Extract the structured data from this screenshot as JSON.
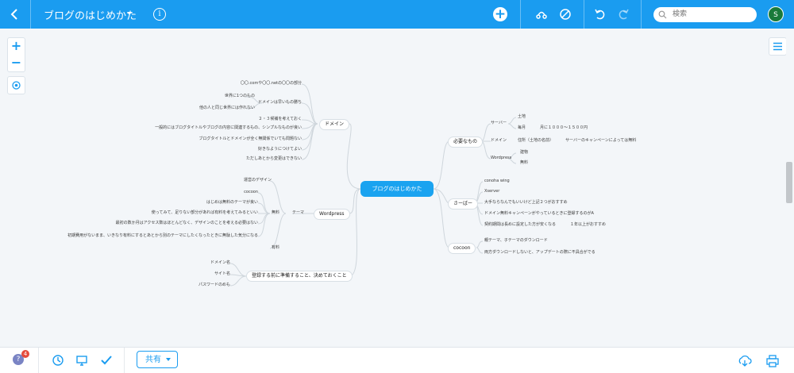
{
  "header": {
    "title": "ブログのはじめかた",
    "search_placeholder": "検索",
    "avatar_initial": "S",
    "accent": "#1a9cf0"
  },
  "bottom": {
    "share_label": "共有",
    "help_glyph": "?",
    "notification_count": "4"
  },
  "mindmap": {
    "root": "ブログのはじめかた",
    "domain": {
      "label": "ドメイン",
      "items": [
        "〇〇.comや〇〇.netの〇〇の部分",
        "世界に1つのもの",
        "ドメインは早いもの勝ち",
        "他の人と同じ世界には作れない",
        "２・３候補を考えておく",
        "一般的にはブログタイトルやブログの内容に関連するもの、シンプルなものが良い",
        "ブログタイトルとドメインが全く無関係でいても問題ない",
        "好きなようにつけてよい",
        "ただしあとから変更はできない"
      ]
    },
    "wordpress": {
      "label": "Wordpress",
      "theme_label": "テーマ",
      "paid_label": "無料",
      "free_label": "有料",
      "items": [
        "運営のデザイン",
        "cocoon",
        "はじめは無料のテーマが良い",
        "使ってみて、足りない部分があれば有料を考えてみるといい",
        "最初の数か月はアクセス数はほとんどなく、デザインのことを考える必要はない",
        "初期費用がないまま、いきなり有料にするとあとから別のテーマにしたくなったときに無駄した気分になる"
      ]
    },
    "prep": {
      "label": "登録する前に準備すること、決めておくこと",
      "items": [
        "ドメイン名",
        "サイト名",
        "パスワードのめも"
      ]
    },
    "needs": {
      "label": "必要なもの",
      "server_label": "サーバー",
      "rent_label": "土地",
      "cost_label": "毎月",
      "cost_value": "月に１０００〜１５００円",
      "domain_label": "ドメイン",
      "domain_note": "住所（土地の名前）",
      "domain_campaign": "サーバーのキャンペーンによっては無料",
      "wordpress_label": "Wordpress",
      "wp_items": [
        "建物",
        "無料"
      ]
    },
    "server": {
      "label": "さーばー",
      "items": [
        "conoha wing",
        "Xserver",
        "大手ならなんでもいいけど上記２つがおすすめ",
        "ドメイン無料キャンペーンがやっているときに登録するのがA",
        "契約期間は長めに設定した方が安くなる",
        "１年以上がおすすめ"
      ]
    },
    "cocoon": {
      "label": "cocoon",
      "items": [
        "親テーマ、子テーマのダウンロード",
        "両方ダウンロードしないと、アップデートの際に不具合がでる"
      ]
    }
  }
}
